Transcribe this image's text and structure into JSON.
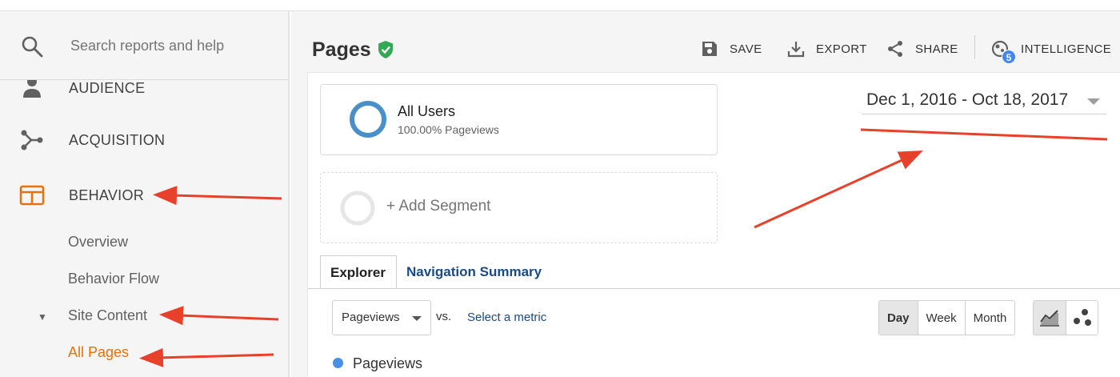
{
  "sidebar": {
    "search": {
      "placeholder": "Search reports and help",
      "icon": "search-icon"
    },
    "items": [
      {
        "label": "AUDIENCE",
        "icon": "person-icon"
      },
      {
        "label": "ACQUISITION",
        "icon": "acquisition-icon"
      },
      {
        "label": "BEHAVIOR",
        "icon": "behavior-icon",
        "accent": "#e8710a"
      }
    ],
    "behavior_sub": {
      "overview": "Overview",
      "behavior_flow": "Behavior Flow",
      "site_content": "Site Content",
      "all_pages": "All Pages"
    }
  },
  "header": {
    "title": "Pages",
    "toolbar": {
      "save": "SAVE",
      "export": "EXPORT",
      "share": "SHARE",
      "intelligence": "INTELLIGENCE",
      "intelligence_badge": "5"
    }
  },
  "segments": {
    "all_users": {
      "name": "All Users",
      "subtitle": "100.00% Pageviews",
      "color": "#4a90c8"
    },
    "add_segment": "+ Add Segment"
  },
  "date_range": "Dec 1, 2016 - Oct 18, 2017",
  "tabs": {
    "explorer": "Explorer",
    "navigation_summary": "Navigation Summary"
  },
  "metric": {
    "selected": "Pageviews",
    "vs": "vs.",
    "select_metric": "Select a metric"
  },
  "granularity": {
    "day": "Day",
    "week": "Week",
    "month": "Month",
    "selected": "Day"
  },
  "legend": {
    "label": "Pageviews",
    "color": "#4a90e2"
  },
  "colors": {
    "accent": "#e8710a",
    "verified": "#34a853",
    "annotation": "#e8412b",
    "link": "#1a4a8a"
  }
}
